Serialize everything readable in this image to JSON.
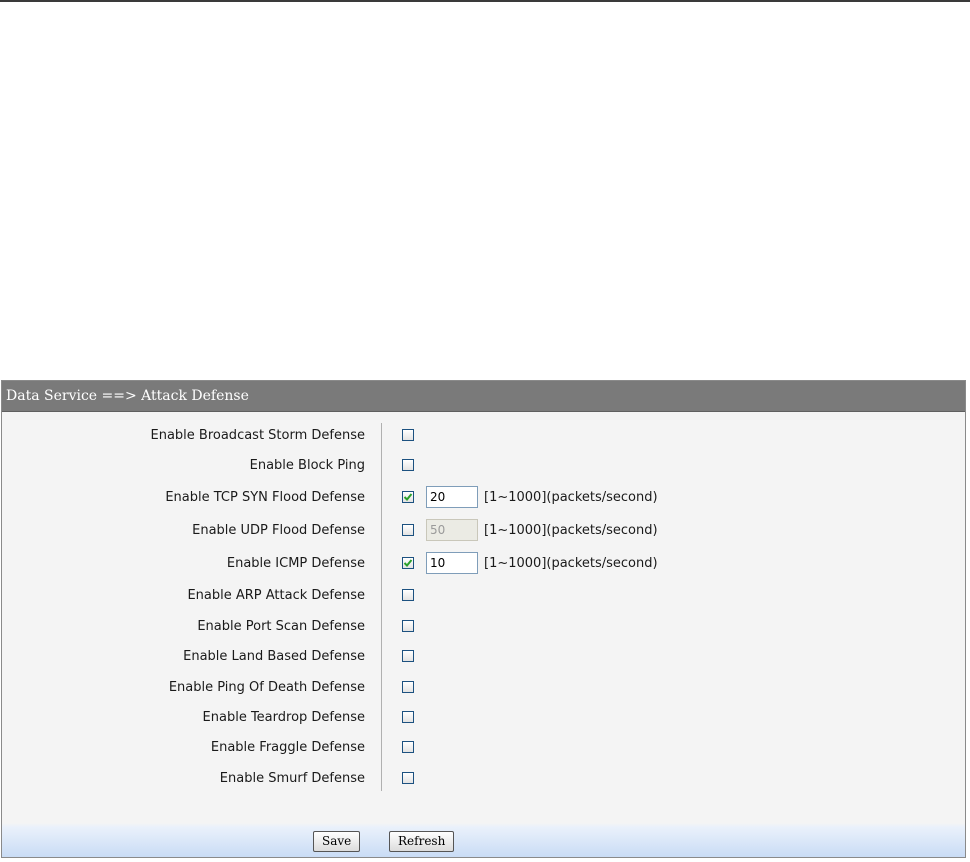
{
  "header": {
    "breadcrumb": "Data Service ==> Attack Defense"
  },
  "options": [
    {
      "label": "Enable Broadcast Storm Defense",
      "checked": false
    },
    {
      "label": "Enable Block Ping",
      "checked": false
    },
    {
      "label": "Enable TCP SYN Flood Defense",
      "checked": true,
      "value": "20",
      "range": "[1~1000](packets/second)"
    },
    {
      "label": "Enable UDP Flood Defense",
      "checked": false,
      "value": "50",
      "disabled": true,
      "range": "[1~1000](packets/second)"
    },
    {
      "label": "Enable ICMP Defense",
      "checked": true,
      "value": "10",
      "range": "[1~1000](packets/second)"
    },
    {
      "label": "Enable ARP Attack Defense",
      "checked": false
    },
    {
      "label": "Enable Port Scan Defense",
      "checked": false
    },
    {
      "label": "Enable Land Based Defense",
      "checked": false
    },
    {
      "label": "Enable Ping Of Death Defense",
      "checked": false
    },
    {
      "label": "Enable Teardrop Defense",
      "checked": false
    },
    {
      "label": "Enable Fraggle Defense",
      "checked": false
    },
    {
      "label": "Enable Smurf Defense",
      "checked": false
    }
  ],
  "buttons": {
    "save": "Save",
    "refresh": "Refresh"
  },
  "colors": {
    "header_bg": "#7a7a7a",
    "check": "#2aa02a",
    "footer_gradient": "#c9dcf5"
  }
}
